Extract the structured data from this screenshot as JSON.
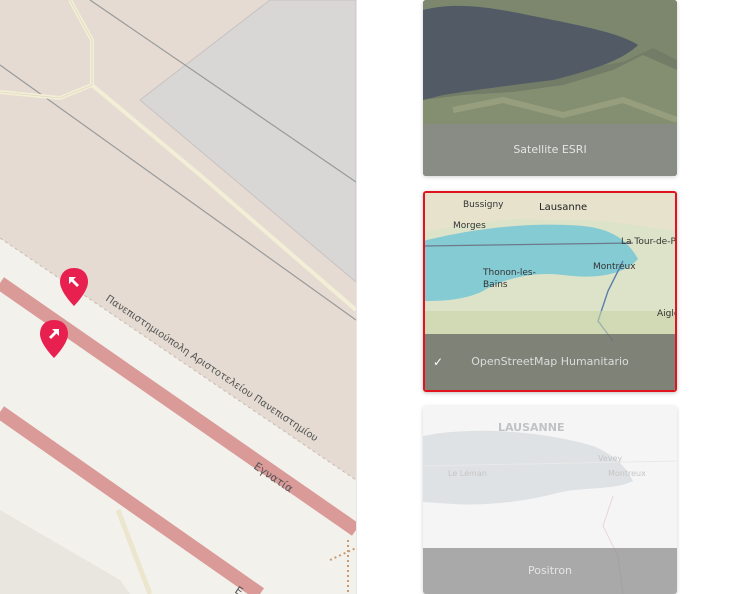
{
  "map": {
    "labels": {
      "university_road": "Πανεπιστημιούπολη Αριστοτελείου Πανεπιστημίου",
      "main_road": "Εγνατία",
      "partial_road": "Ε"
    },
    "markers": [
      {
        "name": "map-marker-1",
        "icon": "arrow-up-left-icon"
      },
      {
        "name": "map-marker-2",
        "icon": "arrow-up-right-icon"
      }
    ],
    "colors": {
      "marker": "#e8204f",
      "main_road": "#d99a98",
      "land": "#e5dbd2",
      "campus": "#f3f1ec"
    }
  },
  "layers": [
    {
      "id": "satellite",
      "label": "Satellite ESRI",
      "selected": false
    },
    {
      "id": "osm-humanitarian",
      "label": "OpenStreetMap Humanitario",
      "selected": true,
      "check": "✓",
      "thumb_places": [
        "Bussigny",
        "Lausanne",
        "Morges",
        "La Tour-de-Pe",
        "Montreux",
        "Thonon-les-",
        "Bains",
        "Aigle"
      ]
    },
    {
      "id": "positron",
      "label": "Positron",
      "selected": false,
      "thumb_places": [
        "LAUSANNE",
        "Le Léman",
        "Vevey",
        "Montreux"
      ]
    }
  ],
  "colors": {
    "selected_border": "#e0141e"
  }
}
